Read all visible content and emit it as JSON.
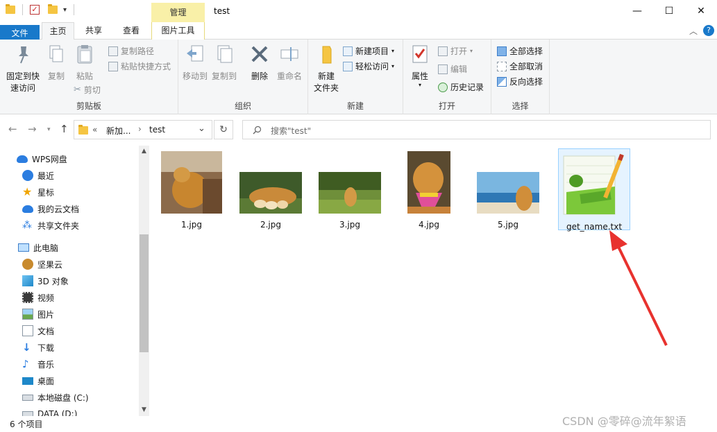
{
  "window": {
    "title": "test",
    "context_tab": "管理",
    "controls": {
      "minimize": "—",
      "maximize": "☐",
      "close": "✕"
    }
  },
  "tabs": {
    "file": "文件",
    "home": "主页",
    "share": "共享",
    "view": "查看",
    "picture_tools": "图片工具"
  },
  "ribbon": {
    "clipboard": {
      "label": "剪贴板",
      "pin": "固定到快\n速访问",
      "pin_line1": "固定到快",
      "pin_line2": "速访问",
      "copy": "复制",
      "paste": "粘贴",
      "copy_path": "复制路径",
      "paste_shortcut": "粘贴快捷方式",
      "cut": "剪切"
    },
    "organize": {
      "label": "组织",
      "move_to": "移动到",
      "copy_to": "复制到",
      "delete": "删除",
      "rename": "重命名"
    },
    "new": {
      "label": "新建",
      "new_folder_line1": "新建",
      "new_folder_line2": "文件夹",
      "new_item": "新建项目",
      "easy_access": "轻松访问"
    },
    "open": {
      "label": "打开",
      "properties": "属性",
      "open": "打开",
      "edit": "编辑",
      "history": "历史记录"
    },
    "select": {
      "label": "选择",
      "select_all": "全部选择",
      "select_none": "全部取消",
      "invert": "反向选择"
    }
  },
  "address": {
    "crumb_overflow": "«",
    "crumb_1": "新加...",
    "crumb_2": "test",
    "search_placeholder": "搜索\"test\""
  },
  "sidebar": {
    "items": [
      {
        "label": "WPS网盘"
      },
      {
        "label": "最近"
      },
      {
        "label": "星标"
      },
      {
        "label": "我的云文档"
      },
      {
        "label": "共享文件夹"
      },
      {
        "label": "此电脑"
      },
      {
        "label": "坚果云"
      },
      {
        "label": "3D 对象"
      },
      {
        "label": "视频"
      },
      {
        "label": "图片"
      },
      {
        "label": "文档"
      },
      {
        "label": "下载"
      },
      {
        "label": "音乐"
      },
      {
        "label": "桌面"
      },
      {
        "label": "本地磁盘 (C:)"
      },
      {
        "label": "DATA (D:)"
      }
    ]
  },
  "files": [
    {
      "name": "1.jpg"
    },
    {
      "name": "2.jpg"
    },
    {
      "name": "3.jpg"
    },
    {
      "name": "4.jpg"
    },
    {
      "name": "5.jpg"
    },
    {
      "name": "get_name.txt"
    }
  ],
  "status": {
    "count": "6 个项目"
  },
  "watermark": "CSDN @零碎@流年絮语",
  "colors": {
    "accent": "#1979ca",
    "annotation_arrow": "#e8322e",
    "context_tab": "#f9f0a8"
  }
}
